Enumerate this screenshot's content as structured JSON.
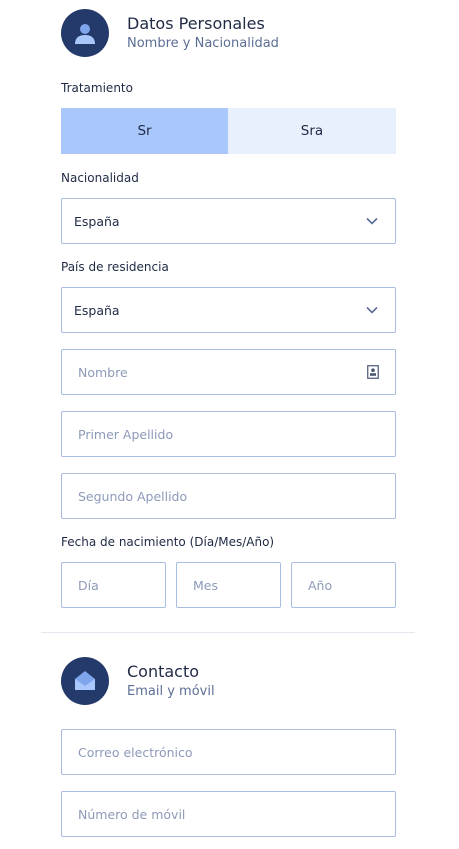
{
  "personal": {
    "title": "Datos Personales",
    "subtitle": "Nombre y Nacionalidad",
    "icon": "user-badge-icon",
    "treatment_label": "Tratamiento",
    "treatment_options": [
      "Sr",
      "Sra"
    ],
    "treatment_selected": "Sr",
    "nationality_label": "Nacionalidad",
    "nationality_value": "España",
    "residence_label": "País de residencia",
    "residence_value": "España",
    "name_placeholder": "Nombre",
    "first_surname_placeholder": "Primer Apellido",
    "second_surname_placeholder": "Segundo Apellido",
    "birthdate_label": "Fecha de nacimiento (Día/Mes/Año)",
    "day_placeholder": "Día",
    "month_placeholder": "Mes",
    "year_placeholder": "Año"
  },
  "contact": {
    "title": "Contacto",
    "subtitle": "Email y móvil",
    "icon": "envelope-icon",
    "email_placeholder": "Correo electrónico",
    "phone_placeholder": "Número de móvil"
  },
  "colors": {
    "icon_bg": "#243a6b",
    "segment_active": "#a9c7fb",
    "segment_inactive": "#e8f0fd",
    "field_border": "#a9bde0",
    "placeholder": "#8d9ab8"
  }
}
